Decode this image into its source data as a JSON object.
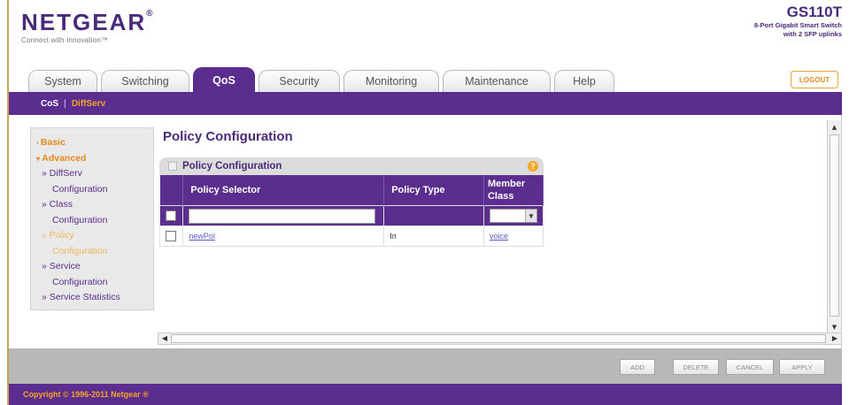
{
  "brand": {
    "logo": "NETGEAR",
    "registered_mark": "®",
    "tagline": "Connect with Innovation™"
  },
  "model": {
    "name": "GS110T",
    "desc_line1": "8-Port Gigabit Smart Switch",
    "desc_line2": "with 2 SFP uplinks"
  },
  "tabs": [
    {
      "label": "System"
    },
    {
      "label": "Switching"
    },
    {
      "label": "QoS",
      "active": true
    },
    {
      "label": "Security"
    },
    {
      "label": "Monitoring"
    },
    {
      "label": "Maintenance"
    },
    {
      "label": "Help"
    }
  ],
  "logout_label": "LOGOUT",
  "subnav": {
    "item1": "CoS",
    "separator": "|",
    "item2": "DiffServ"
  },
  "sidebar": {
    "basic": "Basic",
    "advanced": "Advanced",
    "items": [
      {
        "label": "» DiffServ"
      },
      {
        "label": "Configuration"
      },
      {
        "label": "» Class"
      },
      {
        "label": "Configuration"
      },
      {
        "label": "» Policy",
        "active": true
      },
      {
        "label": "Configuration",
        "active": true
      },
      {
        "label": "» Service"
      },
      {
        "label": "Configuration"
      },
      {
        "label": "» Service Statistics"
      }
    ]
  },
  "page_title": "Policy Configuration",
  "panel": {
    "title": "Policy Configuration",
    "help_glyph": "?",
    "columns": [
      "Policy Selector",
      "Policy Type",
      "Member Class"
    ],
    "input_row": {
      "selector_value": "",
      "type_value": "",
      "member_value": ""
    },
    "rows": [
      {
        "selector": "newPol",
        "type": "In",
        "member": "voice"
      }
    ]
  },
  "buttons": {
    "add": "ADD",
    "delete": "DELETE",
    "cancel": "CANCEL",
    "apply": "APPLY"
  },
  "footer": "Copyright © 1996-2011 Netgear ®",
  "colors": {
    "brand_purple": "#5b2d8e",
    "accent_orange": "#f5a623"
  }
}
